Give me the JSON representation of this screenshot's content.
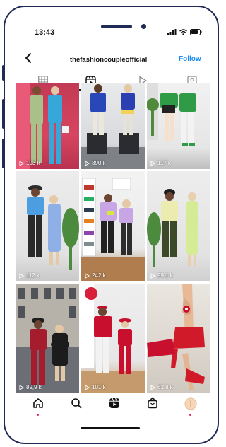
{
  "status": {
    "time": "13:43"
  },
  "header": {
    "username": "thefashioncoupleofficial_",
    "follow_label": "Follow"
  },
  "tabs": [
    {
      "icon": "grid-icon",
      "active": false
    },
    {
      "icon": "reels-icon",
      "active": true
    },
    {
      "icon": "play-icon",
      "active": false
    },
    {
      "icon": "tagged-icon",
      "active": false
    }
  ],
  "reels": [
    {
      "views": "103 k"
    },
    {
      "views": "390 k"
    },
    {
      "views": "117 k"
    },
    {
      "views": "112 k"
    },
    {
      "views": "242 k"
    },
    {
      "views": "99,1 k"
    },
    {
      "views": "89,9 k"
    },
    {
      "views": "101 k"
    },
    {
      "views": "62,8 k"
    }
  ],
  "bottom_nav": [
    {
      "icon": "home-icon",
      "active": true
    },
    {
      "icon": "search-icon",
      "active": false
    },
    {
      "icon": "reels-icon",
      "active": false
    },
    {
      "icon": "shop-icon",
      "active": false
    },
    {
      "icon": "profile-avatar-icon",
      "active": false
    }
  ],
  "colors": {
    "device_frame": "#1f2a55",
    "follow": "#1a8cf0",
    "notification_dot": "#e0245e"
  }
}
